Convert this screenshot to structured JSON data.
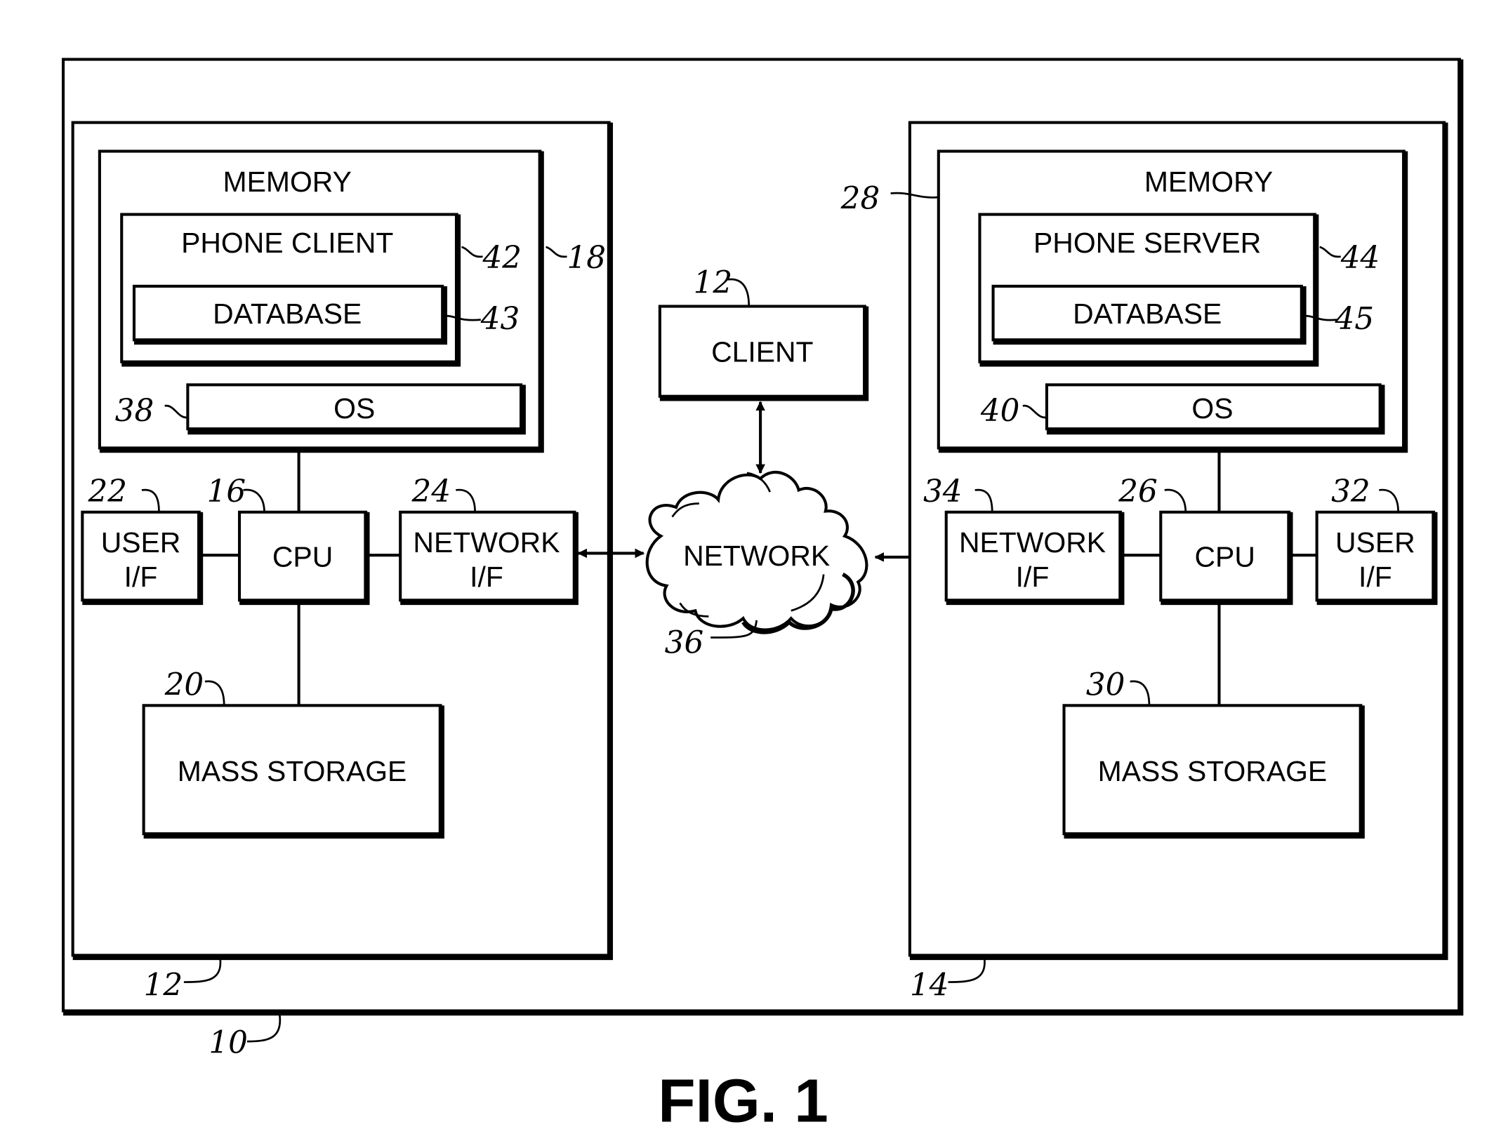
{
  "figure_label": "FIG. 1",
  "system": {
    "ref": "10"
  },
  "client_device": {
    "ref": "12",
    "memory": {
      "label": "MEMORY",
      "ref": "18"
    },
    "phone_client": {
      "label": "PHONE CLIENT",
      "ref": "42"
    },
    "database": {
      "label": "DATABASE",
      "ref": "43"
    },
    "os": {
      "label": "OS",
      "ref": "38"
    },
    "user_if": {
      "label_line1": "USER",
      "label_line2": "I/F",
      "ref": "22"
    },
    "cpu": {
      "label": "CPU",
      "ref": "16"
    },
    "network_if": {
      "label_line1": "NETWORK",
      "label_line2": "I/F",
      "ref": "24"
    },
    "mass_storage": {
      "label": "MASS STORAGE",
      "ref": "20"
    }
  },
  "client": {
    "label": "CLIENT",
    "ref": "12"
  },
  "network": {
    "label": "NETWORK",
    "ref": "36"
  },
  "server_device": {
    "ref": "14",
    "memory": {
      "label": "MEMORY",
      "ref": "28"
    },
    "phone_server": {
      "label": "PHONE SERVER",
      "ref": "44"
    },
    "database": {
      "label": "DATABASE",
      "ref": "45"
    },
    "os": {
      "label": "OS",
      "ref": "40"
    },
    "network_if": {
      "label_line1": "NETWORK",
      "label_line2": "I/F",
      "ref": "34"
    },
    "cpu": {
      "label": "CPU",
      "ref": "26"
    },
    "user_if": {
      "label_line1": "USER",
      "label_line2": "I/F",
      "ref": "32"
    },
    "mass_storage": {
      "label": "MASS STORAGE",
      "ref": "30"
    }
  }
}
